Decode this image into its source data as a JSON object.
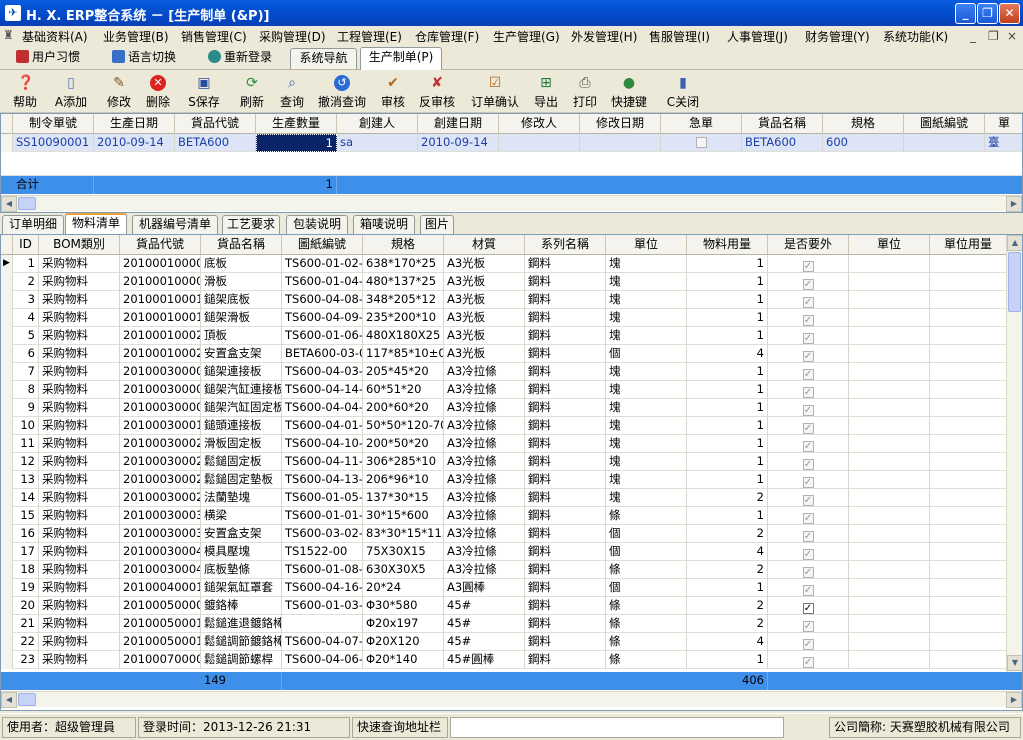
{
  "title": "H. X. ERP整合系统 － [生产制单 (&P)]",
  "window_controls": {
    "minimize": "_",
    "restore": "❐",
    "close": "✕"
  },
  "menu": [
    {
      "label": "基础资料(A)"
    },
    {
      "label": "业务管理(B)"
    },
    {
      "label": "销售管理(C)"
    },
    {
      "label": "采购管理(D)"
    },
    {
      "label": "工程管理(E)"
    },
    {
      "label": "仓库管理(F)"
    },
    {
      "label": "生产管理(G)"
    },
    {
      "label": "外发管理(H)"
    },
    {
      "label": "售服管理(I)"
    },
    {
      "label": "人事管理(J)"
    },
    {
      "label": "财务管理(Y)"
    },
    {
      "label": "系统功能(K)"
    }
  ],
  "mdi_controls": {
    "minimize": "_",
    "restore": "❐",
    "close": "×"
  },
  "quickbar": {
    "habit": "用户习惯",
    "language": "语言切换",
    "relogin": "重新登录"
  },
  "nav_tabs": [
    {
      "label": "系统导航"
    },
    {
      "label": "生产制单(P)"
    }
  ],
  "toolbar": [
    {
      "label": "帮助",
      "icon": "help-icon"
    },
    {
      "label": "A添加",
      "icon": "add-icon"
    },
    {
      "label": "修改",
      "icon": "edit-icon"
    },
    {
      "label": "删除",
      "icon": "delete-icon"
    },
    {
      "label": "S保存",
      "icon": "save-icon"
    },
    {
      "label": "刷新",
      "icon": "refresh-icon"
    },
    {
      "label": "查询",
      "icon": "query-icon"
    },
    {
      "label": "撤消查询",
      "icon": "undo-query-icon"
    },
    {
      "label": "审核",
      "icon": "audit-icon"
    },
    {
      "label": "反审核",
      "icon": "unaudit-icon"
    },
    {
      "label": "订单确认",
      "icon": "confirm-icon"
    },
    {
      "label": "导出",
      "icon": "export-icon"
    },
    {
      "label": "打印",
      "icon": "print-icon"
    },
    {
      "label": "快捷键",
      "icon": "shortcut-icon"
    },
    {
      "label": "C关闭",
      "icon": "close-icon"
    }
  ],
  "order_grid": {
    "columns": [
      "制令單號",
      "生產日期",
      "貨品代號",
      "生產數量",
      "創建人",
      "創建日期",
      "修改人",
      "修改日期",
      "急單",
      "貨品名稱",
      "規格",
      "圖紙編號",
      "單"
    ],
    "row": {
      "order_no": "SS10090001",
      "prod_date": "2010-09-14",
      "item_code": "BETA600",
      "qty": "1",
      "creator": "sa",
      "create_date": "2010-09-14",
      "modifier": "",
      "modify_date": "",
      "urgent": false,
      "item_name": "BETA600",
      "spec": "600",
      "drawing": "",
      "unit": "臺"
    },
    "total_label": "合计",
    "total_qty": "1"
  },
  "sub_tabs": [
    {
      "label": "订单明细"
    },
    {
      "label": "物料清单"
    },
    {
      "label": "机器编号清单"
    },
    {
      "label": "工艺要求"
    },
    {
      "label": "包装说明"
    },
    {
      "label": "箱唛说明"
    },
    {
      "label": "图片"
    }
  ],
  "bom_grid": {
    "columns": [
      "ID",
      "BOM類別",
      "貨品代號",
      "貨品名稱",
      "圖紙編號",
      "規格",
      "材質",
      "系列名稱",
      "單位",
      "物料用量",
      "是否要外",
      "單位",
      "單位用量"
    ],
    "rows": [
      [
        "1",
        "采购物料",
        "201000100008",
        "底板",
        "TS600-01-02-00",
        "638*170*25",
        "A3光板",
        "鋼料",
        "塊",
        "1",
        false
      ],
      [
        "2",
        "采购物料",
        "201000100009",
        "滑板",
        "TS600-01-04-00",
        "480*137*25",
        "A3光板",
        "鋼料",
        "塊",
        "1",
        false
      ],
      [
        "3",
        "采购物料",
        "201000100018",
        "鎚架底板",
        "TS600-04-08-01",
        "348*205*12",
        "A3光板",
        "鋼料",
        "塊",
        "1",
        false
      ],
      [
        "4",
        "采购物料",
        "201000100019",
        "鎚架滑板",
        "TS600-04-09-00",
        "235*200*10",
        "A3光板",
        "鋼料",
        "塊",
        "1",
        false
      ],
      [
        "5",
        "采购物料",
        "201000100026",
        "頂板",
        "TS600-01-06-01",
        "480X180X25",
        "A3光板",
        "鋼料",
        "塊",
        "1",
        false
      ],
      [
        "6",
        "采购物料",
        "201000100027",
        "安置盒支架",
        "BETA600-03-01",
        "117*85*10±0.2",
        "A3光板",
        "鋼料",
        "個",
        "4",
        false
      ],
      [
        "7",
        "采购物料",
        "201000300001",
        "鎚架連接板",
        "TS600-04-03-00",
        "205*45*20",
        "A3冷拉條",
        "鋼料",
        "塊",
        "1",
        false
      ],
      [
        "8",
        "采购物料",
        "201000300002",
        "鎚架汽缸連接板",
        "TS600-04-14-01",
        "60*51*20",
        "A3冷拉條",
        "鋼料",
        "塊",
        "1",
        false
      ],
      [
        "9",
        "采购物料",
        "201000300003",
        "鎚架汽缸固定板",
        "TS600-04-04-00",
        "200*60*20",
        "A3冷拉條",
        "鋼料",
        "塊",
        "1",
        false
      ],
      [
        "10",
        "采购物料",
        "201000300014",
        "鎚頭連接板",
        "TS600-04-01-02",
        "50*50*120-70*70",
        "A3冷拉條",
        "鋼料",
        "塊",
        "1",
        false
      ],
      [
        "11",
        "采购物料",
        "201000300020",
        "滑板固定板",
        "TS600-04-10-00",
        "200*50*20",
        "A3冷拉條",
        "鋼料",
        "塊",
        "1",
        false
      ],
      [
        "12",
        "采购物料",
        "201000300021",
        "鬆鎚固定板",
        "TS600-04-11-00",
        "306*285*10",
        "A3冷拉條",
        "鋼料",
        "塊",
        "1",
        false
      ],
      [
        "13",
        "采购物料",
        "201000300023",
        "鬆鎚固定墊板",
        "TS600-04-13-00",
        "206*96*10",
        "A3冷拉條",
        "鋼料",
        "塊",
        "1",
        false
      ],
      [
        "14",
        "采购物料",
        "201000300026",
        "法蘭墊塊",
        "TS600-01-05-00",
        "137*30*15",
        "A3冷拉條",
        "鋼料",
        "塊",
        "2",
        false
      ],
      [
        "15",
        "采购物料",
        "201000300030",
        "横梁",
        "TS600-01-01-00",
        "30*15*600",
        "A3冷拉條",
        "鋼料",
        "條",
        "1",
        false
      ],
      [
        "16",
        "采购物料",
        "201000300038",
        "安置盒支架",
        "TS600-03-02-02",
        "83*30*15*115*80",
        "A3冷拉條",
        "鋼料",
        "個",
        "2",
        false
      ],
      [
        "17",
        "采购物料",
        "201000300046",
        "模具壓塊",
        "TS1522-00",
        "75X30X15",
        "A3冷拉條",
        "鋼料",
        "個",
        "4",
        false
      ],
      [
        "18",
        "采购物料",
        "201000300047",
        "底板墊條",
        "TS600-01-08-00",
        "630X30X5",
        "A3冷拉條",
        "鋼料",
        "條",
        "2",
        false
      ],
      [
        "19",
        "采购物料",
        "201000400016",
        "鎚架氣缸罩套",
        "TS600-04-16-00",
        "20*24",
        "A3圓棒",
        "鋼料",
        "個",
        "1",
        false
      ],
      [
        "20",
        "采购物料",
        "201000500005",
        "鍍鉻棒",
        "TS600-01-03-01",
        "Φ30*580",
        "45#",
        "鋼料",
        "條",
        "2",
        true
      ],
      [
        "21",
        "采购物料",
        "201000500011",
        "鬆鎚進退鍍鉻棒",
        "",
        "Φ20x197",
        "45#",
        "鋼料",
        "條",
        "2",
        false
      ],
      [
        "22",
        "采购物料",
        "201000500014",
        "鬆鎚調節鍍鉻棒",
        "TS600-04-07-00",
        "Φ20X120",
        "45#",
        "鋼料",
        "條",
        "4",
        false
      ],
      [
        "23",
        "采购物料",
        "201000700001",
        "鬆鎚調節螺桿",
        "TS600-04-06-00",
        "Φ20*140",
        "45#圓棒",
        "鋼料",
        "條",
        "1",
        false
      ]
    ],
    "total_count": "149",
    "total_qty": "406"
  },
  "statusbar": {
    "user": "使用者：超级管理員",
    "login_time": "登录时间：2013-12-26 21:31",
    "quick_query_label": "快速查询地址栏",
    "quick_query_value": "",
    "company": "公司簡称: 天赛塑胶机械有限公司"
  }
}
